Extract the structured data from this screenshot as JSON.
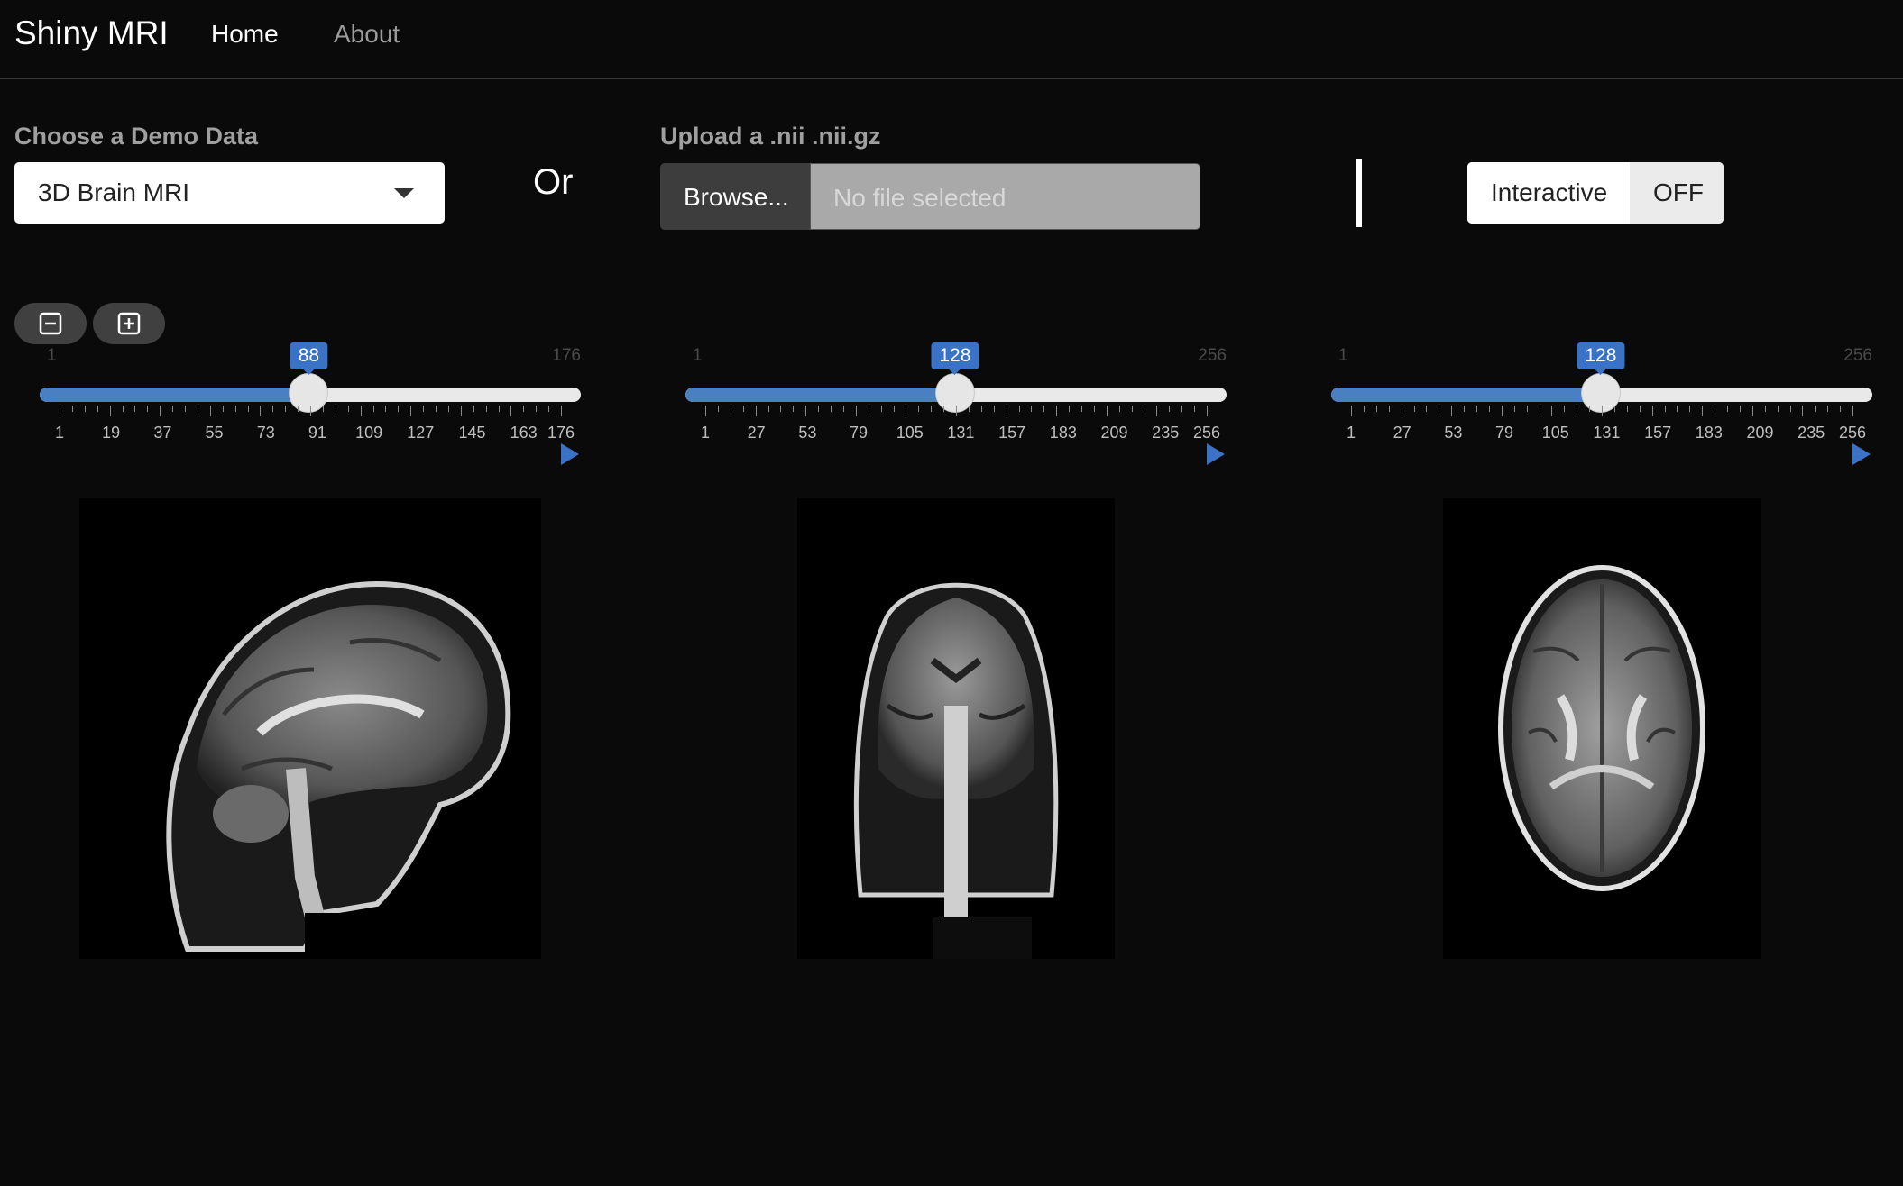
{
  "navbar": {
    "brand": "Shiny MRI",
    "links": [
      {
        "label": "Home",
        "active": true
      },
      {
        "label": "About",
        "active": false
      }
    ]
  },
  "demo": {
    "label": "Choose a Demo Data",
    "selected": "3D Brain MRI"
  },
  "or_text": "Or",
  "upload": {
    "label": "Upload a .nii .nii.gz",
    "button_label": "Browse...",
    "placeholder": "No file selected"
  },
  "toggle": {
    "on_label": "Interactive",
    "off_label": "OFF"
  },
  "zoom": {
    "out_icon": "minus-square-icon",
    "in_icon": "plus-square-icon"
  },
  "colors": {
    "accent": "#3a72c5",
    "fill": "#4a7fc1",
    "background": "#0a0a0a"
  },
  "sliders": [
    {
      "name": "sagittal",
      "min": 1,
      "max": 176,
      "value": 88,
      "min_label": "1",
      "max_label": "176",
      "value_label": "88",
      "ticks": [
        "1",
        "19",
        "37",
        "55",
        "73",
        "91",
        "109",
        "127",
        "145",
        "163",
        "176"
      ],
      "tick_values": [
        1,
        19,
        37,
        55,
        73,
        91,
        109,
        127,
        145,
        163,
        176
      ]
    },
    {
      "name": "coronal",
      "min": 1,
      "max": 256,
      "value": 128,
      "min_label": "1",
      "max_label": "256",
      "value_label": "128",
      "ticks": [
        "1",
        "27",
        "53",
        "79",
        "105",
        "131",
        "157",
        "183",
        "209",
        "235",
        "256"
      ],
      "tick_values": [
        1,
        27,
        53,
        79,
        105,
        131,
        157,
        183,
        209,
        235,
        256
      ]
    },
    {
      "name": "axial",
      "min": 1,
      "max": 256,
      "value": 128,
      "min_label": "1",
      "max_label": "256",
      "value_label": "128",
      "ticks": [
        "1",
        "27",
        "53",
        "79",
        "105",
        "131",
        "157",
        "183",
        "209",
        "235",
        "256"
      ],
      "tick_values": [
        1,
        27,
        53,
        79,
        105,
        131,
        157,
        183,
        209,
        235,
        256
      ]
    }
  ],
  "images": [
    {
      "name": "sagittal-mri-slice"
    },
    {
      "name": "coronal-mri-slice"
    },
    {
      "name": "axial-mri-slice"
    }
  ]
}
